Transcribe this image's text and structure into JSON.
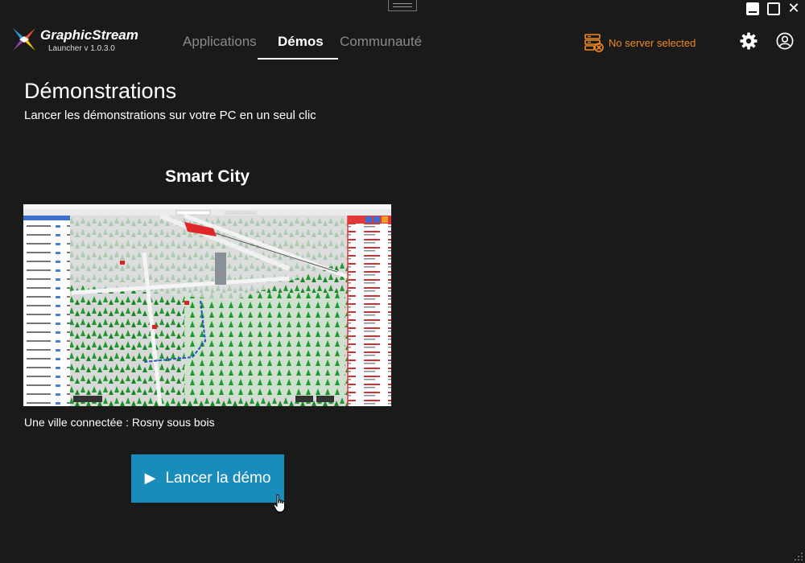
{
  "app": {
    "name": "GraphicStream",
    "version": "Launcher v 1.0.3.0"
  },
  "nav": {
    "tabs": [
      {
        "label": "Applications",
        "active": false
      },
      {
        "label": "Démos",
        "active": true
      },
      {
        "label": "Communauté",
        "active": false
      }
    ]
  },
  "server": {
    "status": "No server selected",
    "color": "#f08a24"
  },
  "icons": {
    "settings": "gear-icon",
    "account": "user-circle-icon",
    "server": "server-error-icon",
    "launch": "play-icon"
  },
  "page": {
    "title": "Démonstrations",
    "subtitle": "Lancer les démonstrations sur votre PC en un seul clic"
  },
  "demo": {
    "title": "Smart City",
    "description": "Une ville connectée : Rosny sous bois",
    "launch_label": "Lancer la démo",
    "launch_glyph": "▶"
  },
  "colors": {
    "background": "#1a1a1a",
    "accent": "#1a8cbc",
    "inactive_tab": "#8a8a8a",
    "warning": "#f08a24"
  }
}
